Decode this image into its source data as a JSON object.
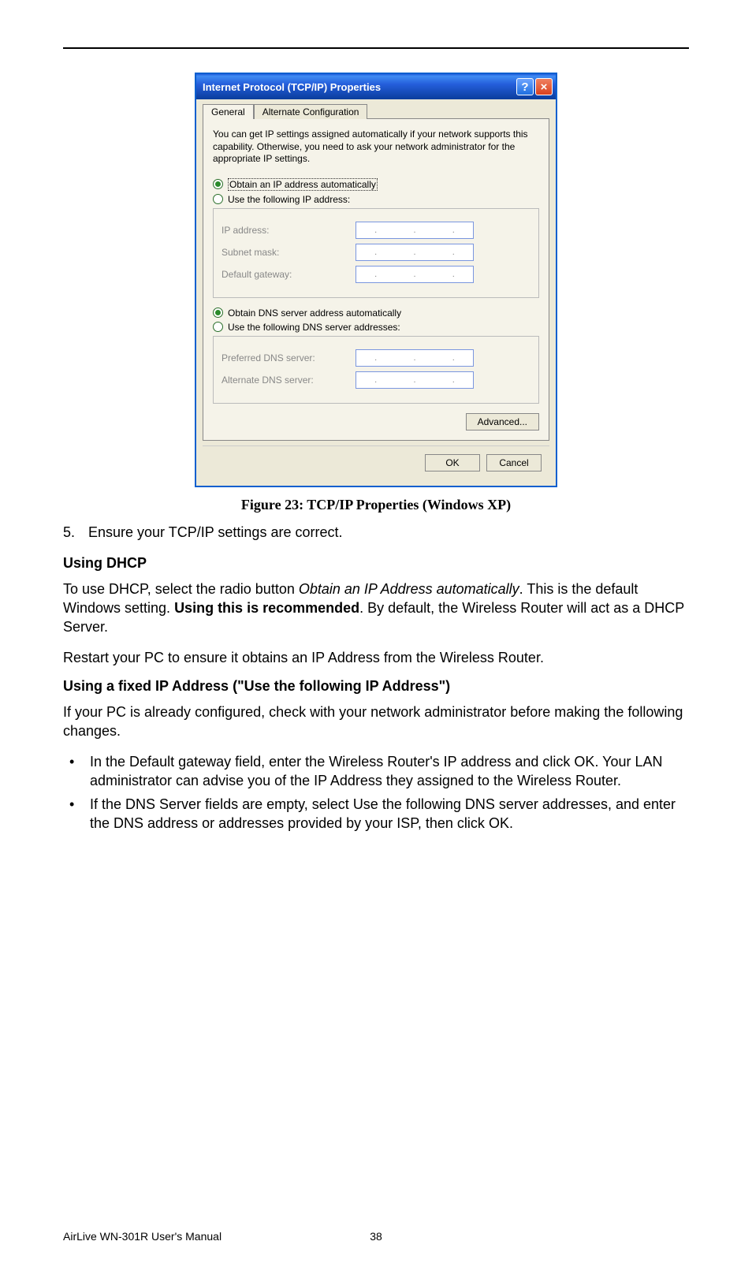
{
  "dialog": {
    "title": "Internet Protocol (TCP/IP) Properties",
    "tabs": {
      "general": "General",
      "alt": "Alternate Configuration"
    },
    "desc": "You can get IP settings assigned automatically if your network supports this capability. Otherwise, you need to ask your network administrator for the appropriate IP settings.",
    "radio_ip_auto": "Obtain an IP address automatically",
    "radio_ip_manual": "Use the following IP address:",
    "labels": {
      "ip": "IP address:",
      "subnet": "Subnet mask:",
      "gateway": "Default gateway:",
      "pref_dns": "Preferred DNS server:",
      "alt_dns": "Alternate DNS server:"
    },
    "radio_dns_auto": "Obtain DNS server address automatically",
    "radio_dns_manual": "Use the following DNS server addresses:",
    "advanced": "Advanced...",
    "ok": "OK",
    "cancel": "Cancel"
  },
  "caption": "Figure 23: TCP/IP Properties (Windows XP)",
  "step5_num": "5.",
  "step5_text": "Ensure your TCP/IP settings are correct.",
  "using_dhcp_heading": "Using DHCP",
  "dhcp_para_pre": "To use DHCP, select the radio button ",
  "dhcp_para_ital": "Obtain an IP Address automatically",
  "dhcp_para_mid": ". This is the default Windows setting. ",
  "dhcp_para_bold": "Using this is recommended",
  "dhcp_para_post": ". By default, the Wireless Router will act as a DHCP Server.",
  "dhcp_restart": "Restart your PC to ensure it obtains an IP Address from the Wireless Router.",
  "fixed_heading": "Using a fixed IP Address (\"Use the following IP Address\")",
  "fixed_intro": "If your PC is already configured, check with your network administrator before making the following changes.",
  "bullets": {
    "b1_pre": "In the ",
    "b1_i1": "Default gateway",
    "b1_mid": " field, enter the Wireless Router's IP address and click ",
    "b1_i2": "OK",
    "b1_post": ". Your LAN administrator can advise you of the IP Address they assigned to the Wireless Router.",
    "b2_pre": "If the ",
    "b2_i1": "DNS Server",
    "b2_mid1": " fields are empty, select ",
    "b2_i2": "Use the following DNS server addresses",
    "b2_mid2": ", and enter the DNS address or addresses provided by your ISP, then click ",
    "b2_i3": "OK",
    "b2_post": "."
  },
  "footer": {
    "manual": "AirLive WN-301R User's Manual",
    "page": "38"
  }
}
